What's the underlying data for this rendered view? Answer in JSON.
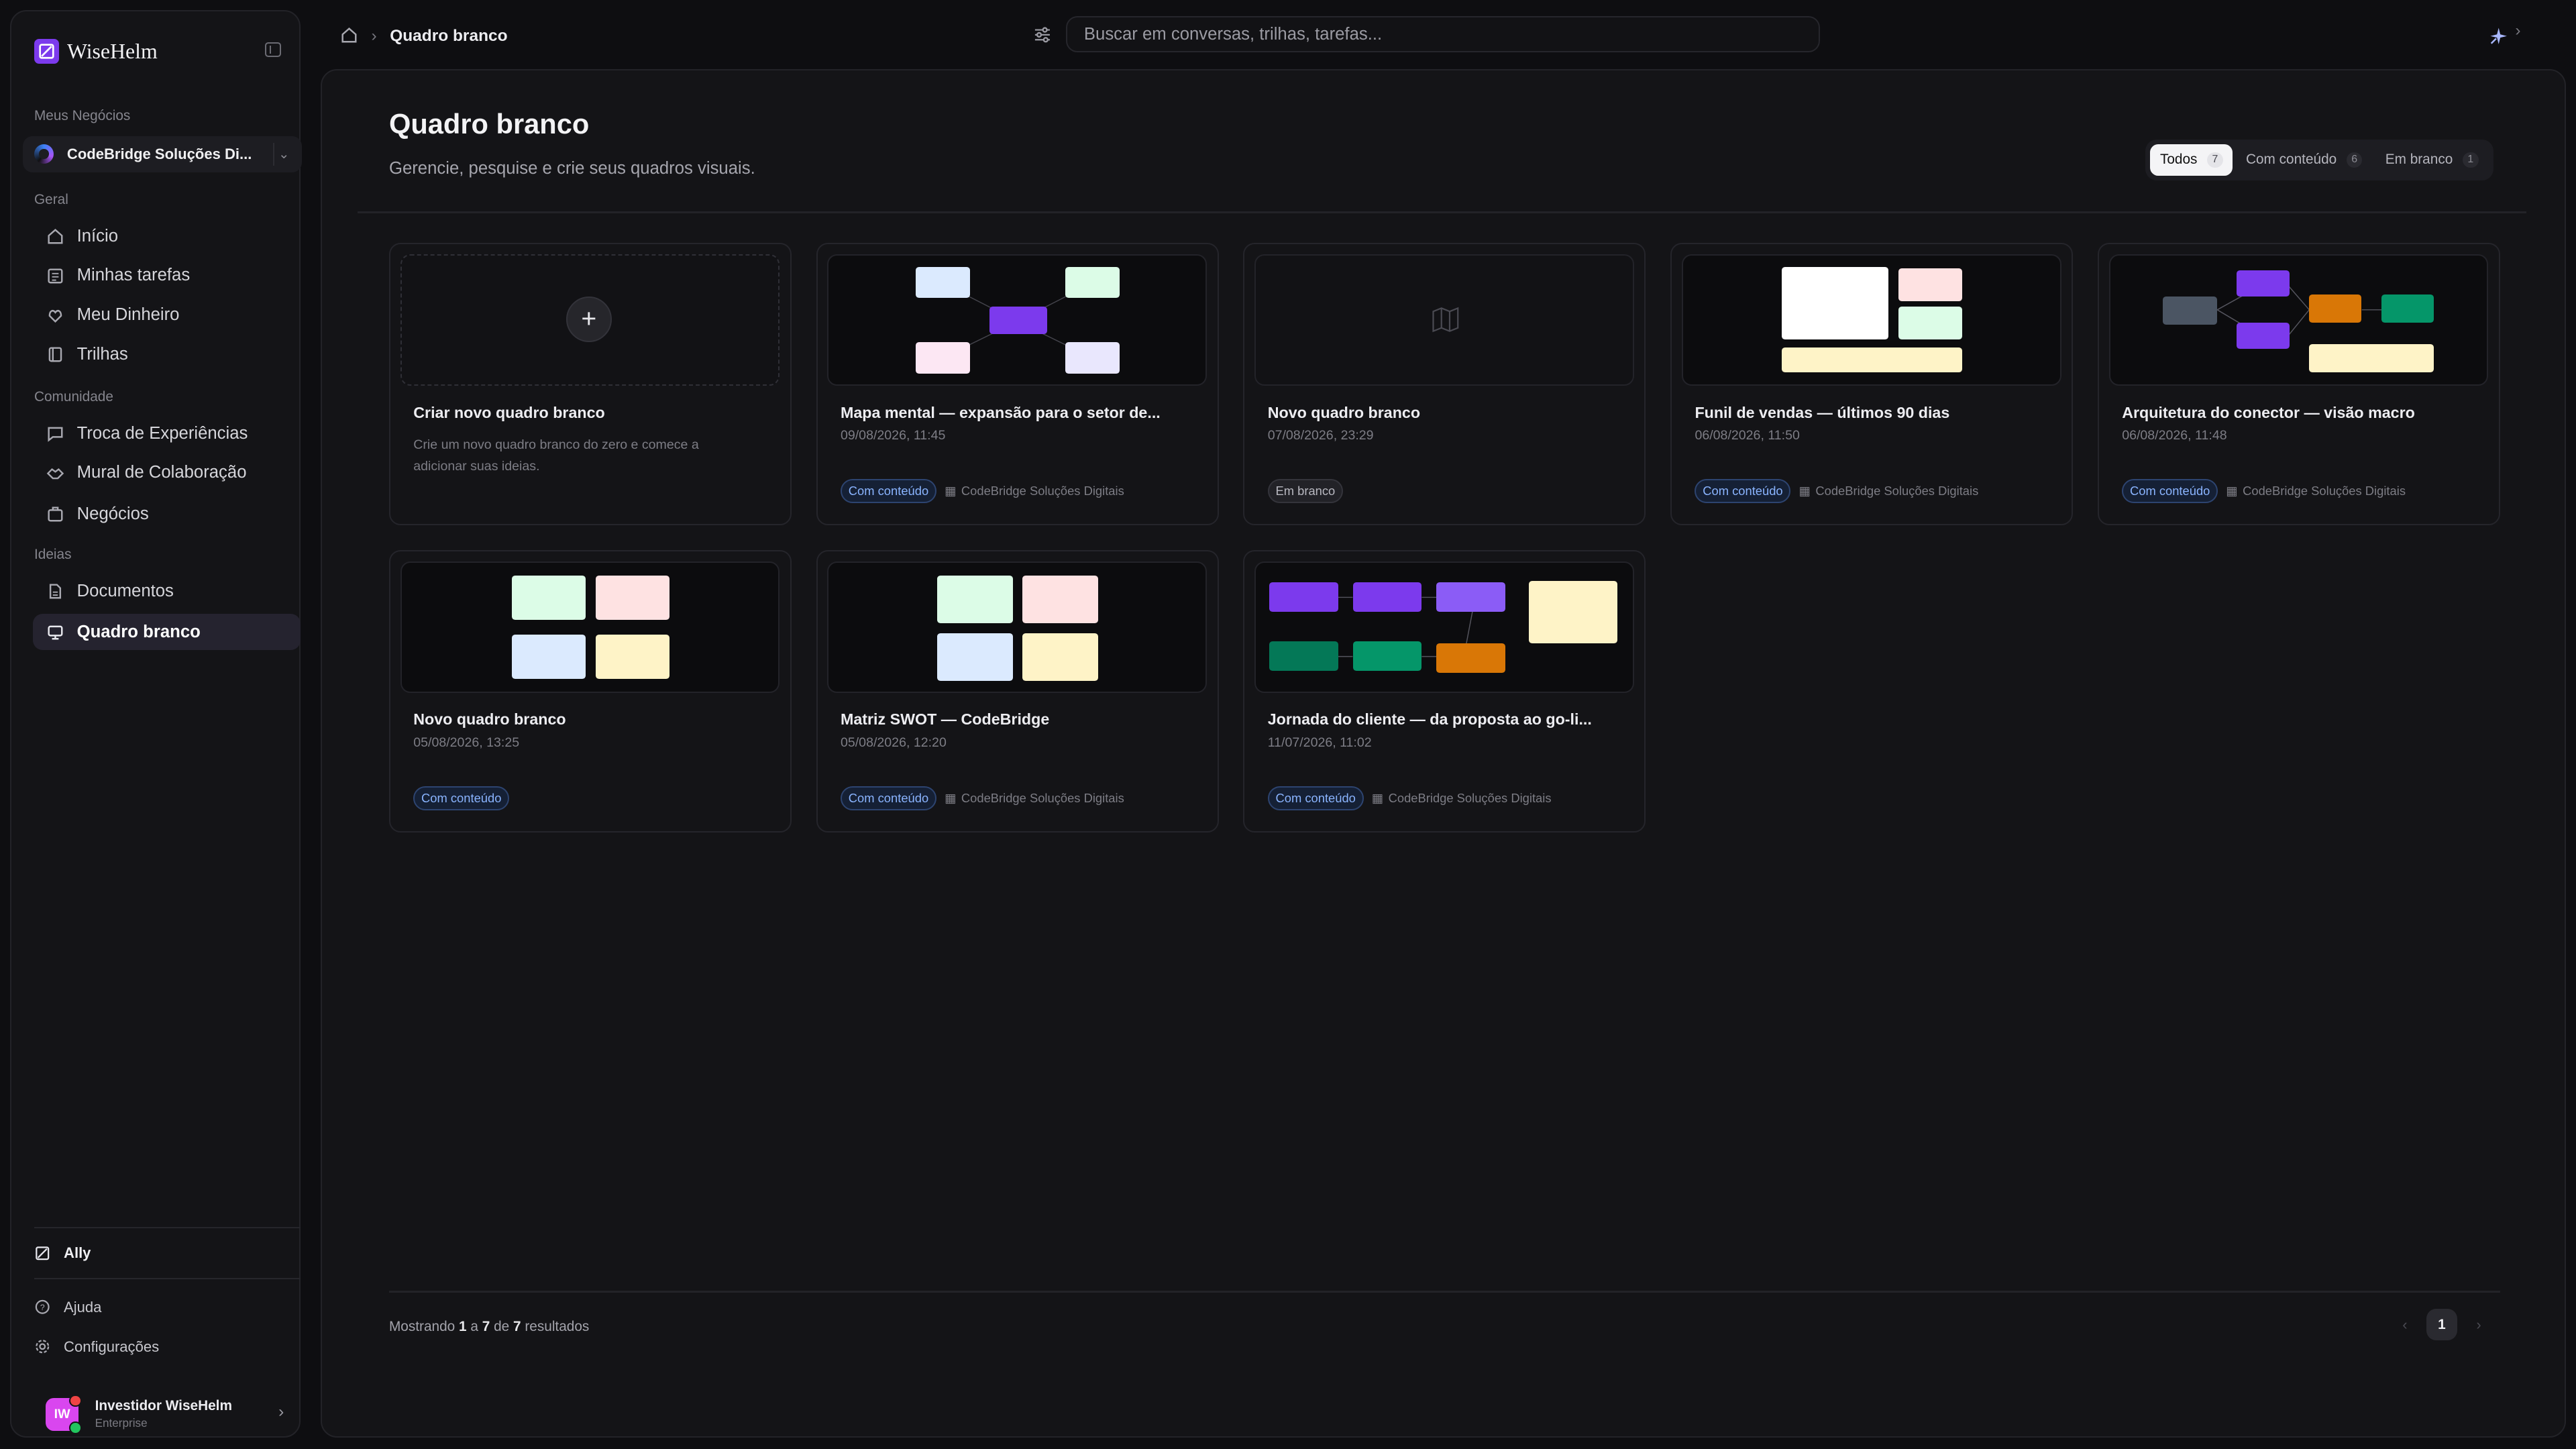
{
  "app": {
    "name": "WiseHelm"
  },
  "sidebar": {
    "business_section": "Meus Negócios",
    "business_name": "CodeBridge Soluções Di...",
    "sections": [
      {
        "title": "Geral",
        "items": [
          {
            "label": "Início",
            "icon": "home-icon"
          },
          {
            "label": "Minhas tarefas",
            "icon": "tasks-icon"
          },
          {
            "label": "Meu Dinheiro",
            "icon": "money-icon"
          },
          {
            "label": "Trilhas",
            "icon": "trail-icon"
          }
        ]
      },
      {
        "title": "Comunidade",
        "items": [
          {
            "label": "Troca de Experiências",
            "icon": "chat-icon"
          },
          {
            "label": "Mural de Colaboração",
            "icon": "collab-icon"
          },
          {
            "label": "Negócios",
            "icon": "business-icon"
          }
        ]
      },
      {
        "title": "Ideias",
        "items": [
          {
            "label": "Documentos",
            "icon": "document-icon"
          },
          {
            "label": "Quadro branco",
            "icon": "whiteboard-icon",
            "active": true
          }
        ]
      }
    ],
    "assistant": "Ally",
    "help": "Ajuda",
    "settings": "Configurações",
    "user": {
      "initials": "IW",
      "name": "Investidor WiseHelm",
      "plan": "Enterprise"
    }
  },
  "topbar": {
    "breadcrumb_current": "Quadro branco",
    "search_placeholder": "Buscar em conversas, trilhas, tarefas..."
  },
  "page": {
    "title": "Quadro branco",
    "subtitle": "Gerencie, pesquise e crie seus quadros visuais.",
    "filters": [
      {
        "label": "Todos",
        "count": "7",
        "active": true
      },
      {
        "label": "Com conteúdo",
        "count": "6"
      },
      {
        "label": "Em branco",
        "count": "1"
      }
    ]
  },
  "create_card": {
    "title": "Criar novo quadro branco",
    "description": "Crie um novo quadro branco do zero e comece a adicionar suas ideias."
  },
  "boards": [
    {
      "title": "Mapa mental — expansão para o setor de...",
      "date": "09/08/2026, 11:45",
      "status": "Com conteúdo",
      "business": "CodeBridge Soluções Digitais"
    },
    {
      "title": "Novo quadro branco",
      "date": "07/08/2026, 23:29",
      "status": "Em branco",
      "business": ""
    },
    {
      "title": "Funil de vendas — últimos 90 dias",
      "date": "06/08/2026, 11:50",
      "status": "Com conteúdo",
      "business": "CodeBridge Soluções Digitais"
    },
    {
      "title": "Arquitetura do conector — visão macro",
      "date": "06/08/2026, 11:48",
      "status": "Com conteúdo",
      "business": "CodeBridge Soluções Digitais"
    },
    {
      "title": "Novo quadro branco",
      "date": "05/08/2026, 13:25",
      "status": "Com conteúdo",
      "business": ""
    },
    {
      "title": "Matriz SWOT — CodeBridge",
      "date": "05/08/2026, 12:20",
      "status": "Com conteúdo",
      "business": "CodeBridge Soluções Digitais"
    },
    {
      "title": "Jornada do cliente — da proposta ao go-li...",
      "date": "11/07/2026, 11:02",
      "status": "Com conteúdo",
      "business": "CodeBridge Soluções Digitais"
    }
  ],
  "footer": {
    "results_prefix": "Mostrando",
    "from": "1",
    "sep1": "a",
    "to": "7",
    "sep2": "de",
    "total": "7",
    "results_suffix": "resultados",
    "page": "1"
  }
}
